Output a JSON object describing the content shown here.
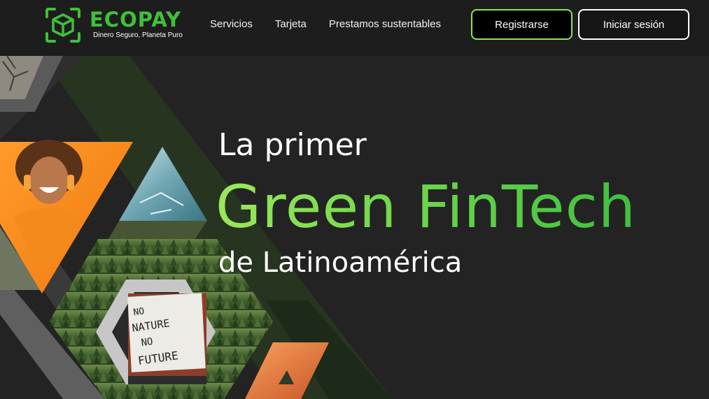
{
  "brand": {
    "name": "ECOPAY",
    "slogan": "Dinero Seguro, Planeta Puro",
    "accent_color": "#3fc03a",
    "icon": "cube-box-icon"
  },
  "nav": {
    "items": [
      {
        "label": "Servicios"
      },
      {
        "label": "Tarjeta"
      },
      {
        "label": "Prestamos sustentables"
      }
    ]
  },
  "actions": {
    "register_label": "Registrarse",
    "login_label": "Iniciar sesión"
  },
  "hero": {
    "line1": "La primer",
    "line2": "Green FinTech",
    "line3": "de Latinoamérica",
    "gradient_start": "#9be85a",
    "gradient_end": "#3fbf3f"
  },
  "collage": {
    "protest_sign_text": "NO NATURE NO FUTURE"
  }
}
